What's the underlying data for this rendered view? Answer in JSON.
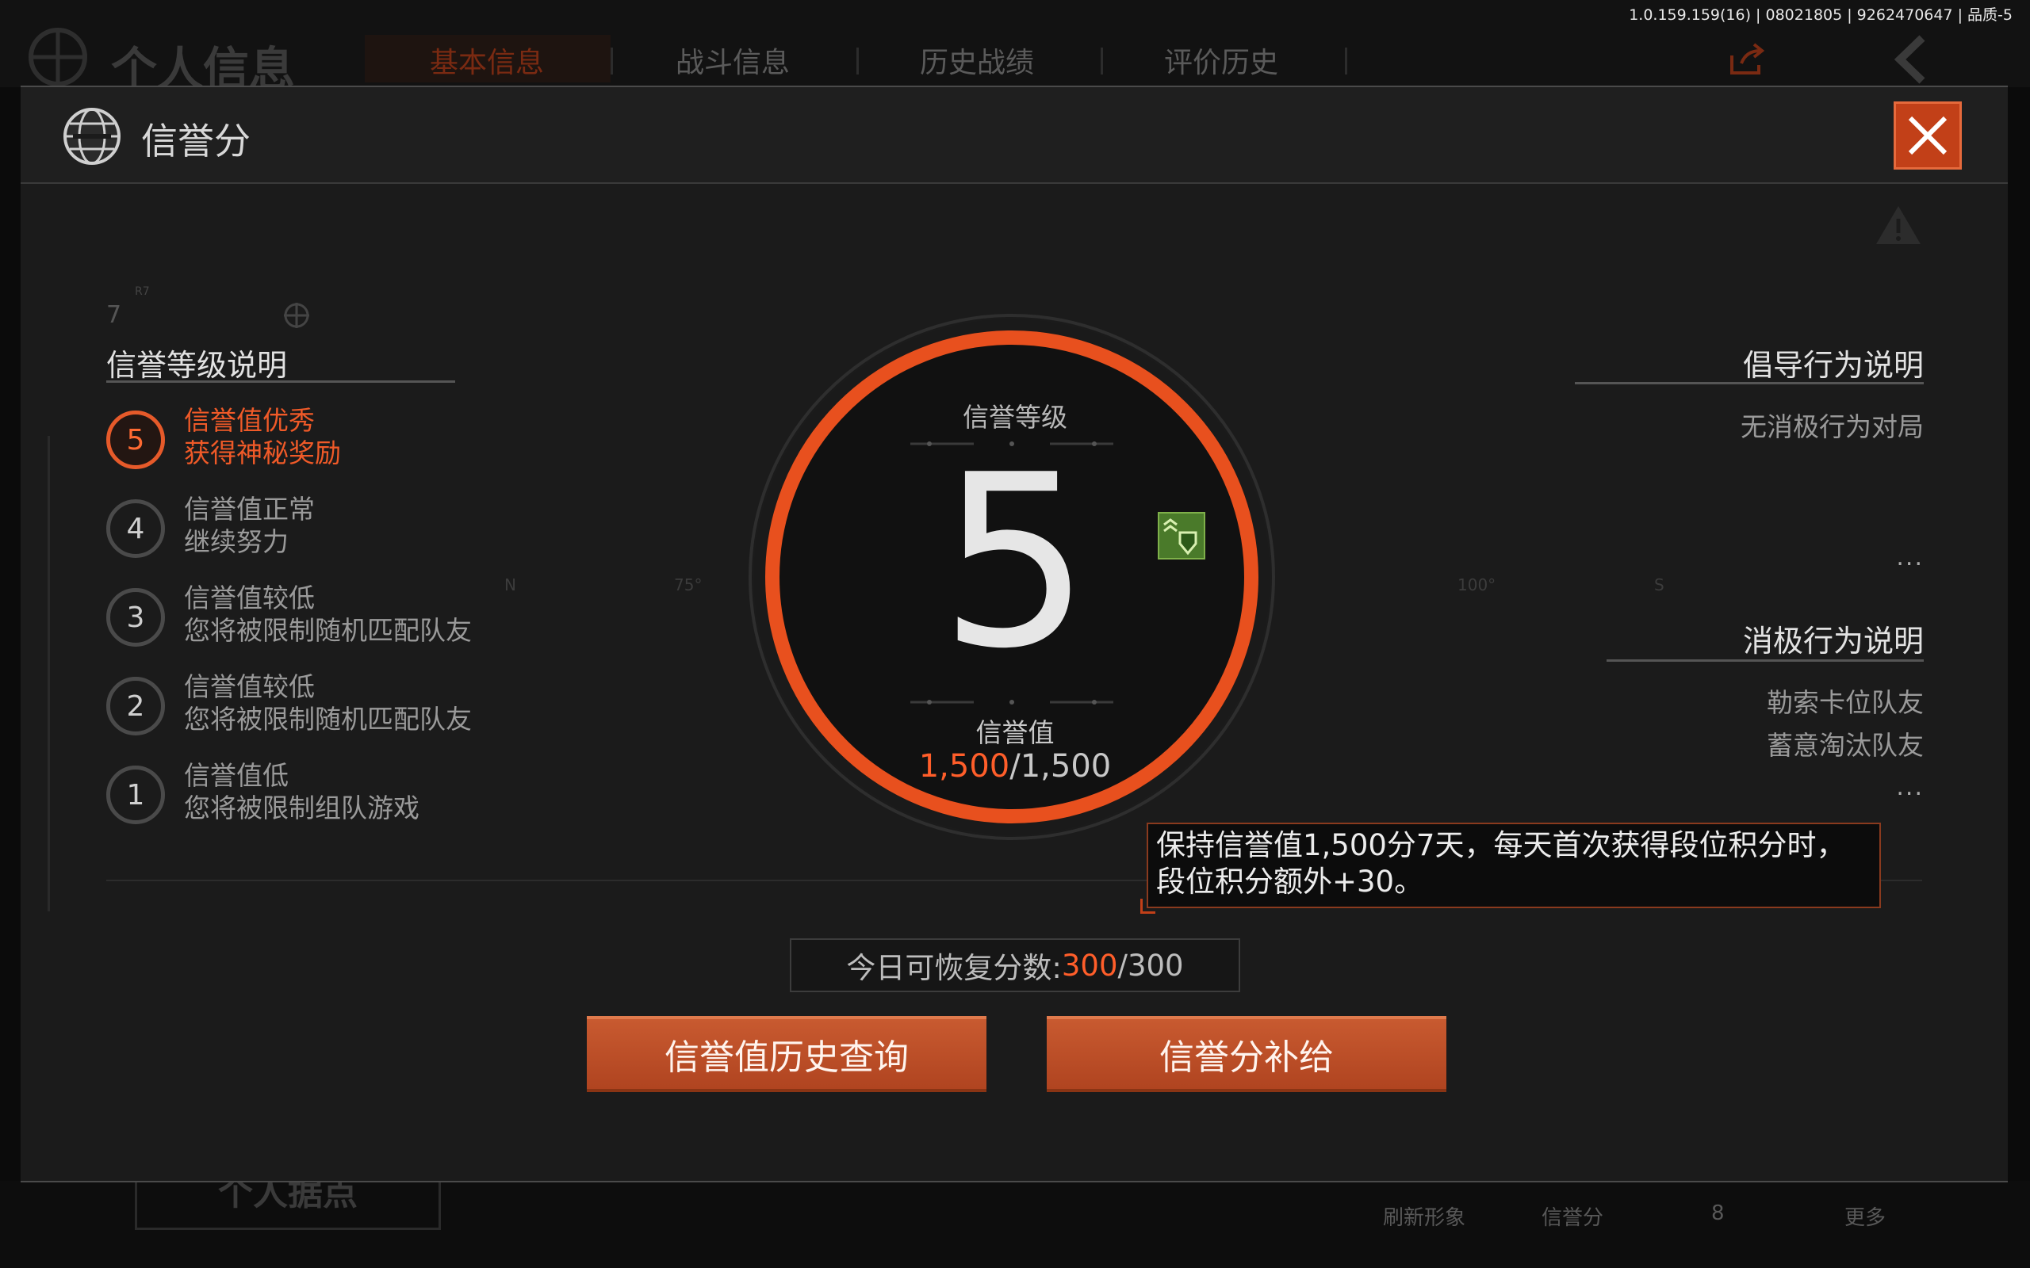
{
  "version_info": "1.0.159.159(16) | 08021805 | 9262470647 | 品质-5",
  "background": {
    "page_title": "个人信息",
    "tabs": [
      {
        "label": "基本信息",
        "active": true
      },
      {
        "label": "战斗信息",
        "active": false
      },
      {
        "label": "历史战绩",
        "active": false
      },
      {
        "label": "评价历史",
        "active": false
      }
    ],
    "base_label": "个人据点",
    "bottom_items": [
      "刷新形象",
      "信誉分",
      "8",
      "更多"
    ]
  },
  "modal": {
    "title": "信誉分",
    "left_section": {
      "title": "信誉等级说明",
      "deco_number": "7",
      "deco_small": "R7",
      "levels": [
        {
          "level": "5",
          "line1": "信誉值优秀",
          "line2": "获得神秘奖励",
          "active": true
        },
        {
          "level": "4",
          "line1": "信誉值正常",
          "line2": "继续努力",
          "active": false
        },
        {
          "level": "3",
          "line1": "信誉值较低",
          "line2": "您将被限制随机匹配队友",
          "active": false
        },
        {
          "level": "2",
          "line1": "信誉值较低",
          "line2": "您将被限制随机匹配队友",
          "active": false
        },
        {
          "level": "1",
          "line1": "信誉值低",
          "line2": "您将被限制组队游戏",
          "active": false
        }
      ]
    },
    "center": {
      "level_label": "信誉等级",
      "level_value": "5",
      "score_label": "信誉值",
      "score_current": "1,500",
      "score_max": "/1,500",
      "ticks": [
        "N",
        "75°",
        "100°",
        "S"
      ]
    },
    "right_section": {
      "encouraged_title": "倡导行为说明",
      "encouraged_items": [
        "无消极行为对局"
      ],
      "negative_title": "消极行为说明",
      "negative_items": [
        "勒索卡位队友",
        "蓄意淘汰队友"
      ],
      "more": "..."
    },
    "tooltip": "保持信誉值1,500分7天，每天首次获得段位积分时，段位积分额外+30。",
    "recovery": {
      "label": "今日可恢复分数:",
      "current": "300",
      "max": "/300"
    },
    "buttons": {
      "history": "信誉值历史查询",
      "replenish": "信誉分补给"
    }
  },
  "colors": {
    "accent": "#e65a2a",
    "ring": "#e8501e"
  }
}
